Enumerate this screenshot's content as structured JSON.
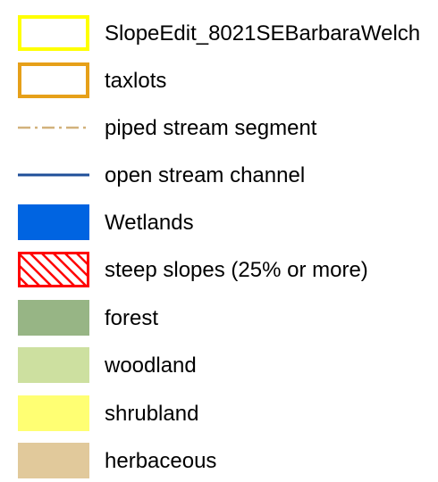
{
  "legend": {
    "items": [
      {
        "label": "SlopeEdit_8021SEBarbaraWelch",
        "symbol": "outline-box",
        "fill": "#ffffff",
        "stroke": "#ffff00",
        "icon": "yellow-outline-box-icon"
      },
      {
        "label": "taxlots",
        "symbol": "outline-box",
        "fill": "#ffffff",
        "stroke": "#e6a019",
        "icon": "orange-outline-box-icon"
      },
      {
        "label": "piped stream segment",
        "symbol": "dash-dot-line",
        "stroke": "#d2b27c",
        "icon": "dash-dot-line-icon"
      },
      {
        "label": "open stream channel",
        "symbol": "solid-line",
        "stroke": "#1f4f99",
        "icon": "solid-line-icon"
      },
      {
        "label": "Wetlands",
        "symbol": "fill-box",
        "fill": "#0064e1",
        "icon": "blue-fill-box-icon"
      },
      {
        "label": "steep slopes (25% or more)",
        "symbol": "hatch-box",
        "stroke": "#ff0000",
        "icon": "red-hatch-box-icon"
      },
      {
        "label": "forest",
        "symbol": "fill-box",
        "fill": "#97b585",
        "icon": "green-fill-box-icon"
      },
      {
        "label": "woodland",
        "symbol": "fill-box",
        "fill": "#cde0a0",
        "icon": "light-green-fill-box-icon"
      },
      {
        "label": "shrubland",
        "symbol": "fill-box",
        "fill": "#ffff73",
        "icon": "yellow-fill-box-icon"
      },
      {
        "label": "herbaceous",
        "symbol": "fill-box",
        "fill": "#e1c99b",
        "icon": "tan-fill-box-icon"
      }
    ]
  }
}
